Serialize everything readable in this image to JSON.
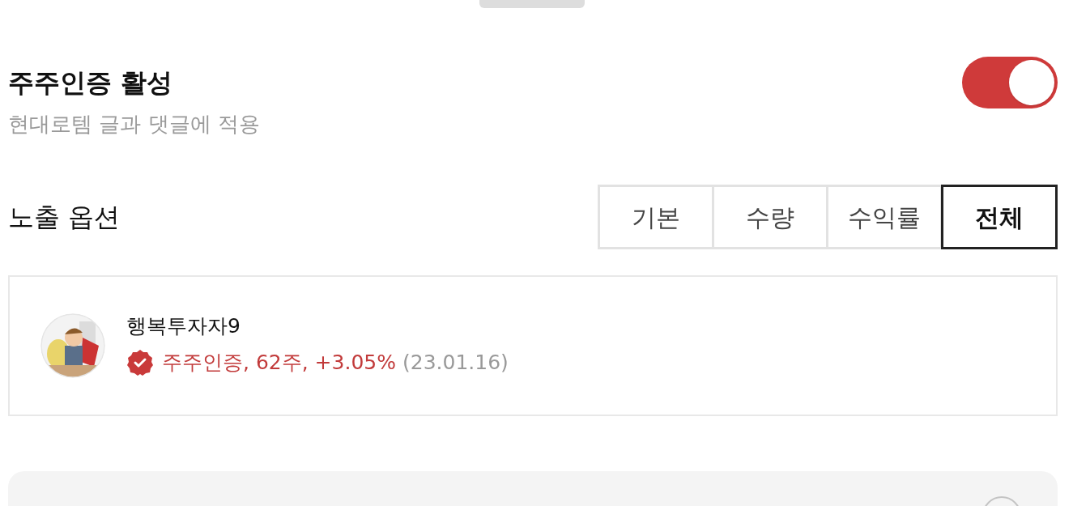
{
  "setting": {
    "title": "주주인증 활성",
    "description": "현대로템 글과 댓글에 적용",
    "on": true
  },
  "display_options": {
    "label": "노출 옵션",
    "tabs": [
      {
        "label": "기본",
        "selected": false
      },
      {
        "label": "수량",
        "selected": false
      },
      {
        "label": "수익률",
        "selected": false
      },
      {
        "label": "전체",
        "selected": true
      }
    ]
  },
  "preview": {
    "username": "행복투자자9",
    "badge_text": "주주인증, 62주, +3.05%",
    "date": "(23.01.16)"
  }
}
